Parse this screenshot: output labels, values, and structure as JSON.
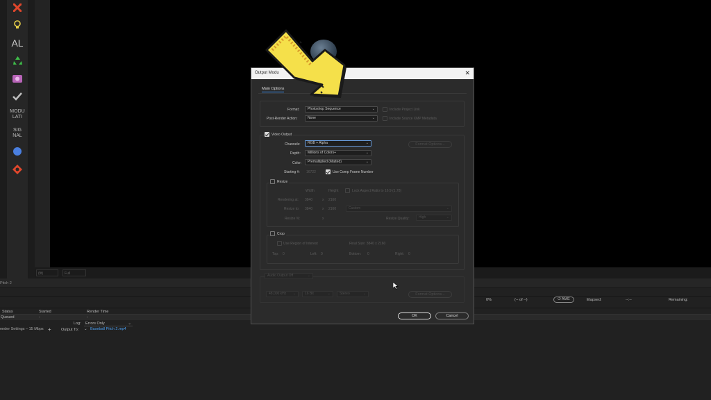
{
  "toolbar": {
    "items": [
      {
        "name": "tool-red-cross-icon",
        "glyph": "✖",
        "color": "#e0472c"
      },
      {
        "name": "lightbulb-icon",
        "glyph": "💡",
        "color": "#e8d04a"
      },
      {
        "name": "al-label",
        "text": "AL"
      },
      {
        "name": "recycle-icon",
        "glyph": "♻",
        "color": "#3fbf4a"
      },
      {
        "name": "camera-icon",
        "glyph": "📷",
        "color": "#c878c8"
      },
      {
        "name": "checkmark-icon",
        "glyph": "✔",
        "color": "#bdbdbd"
      },
      {
        "name": "modulati-label",
        "text": "MODU\nLATI"
      },
      {
        "name": "signal-label",
        "text": "SIG\nNAL"
      },
      {
        "name": "blue-dot-icon",
        "glyph": "●",
        "color": "#4a7fe0"
      },
      {
        "name": "diamond-icon",
        "glyph": "✢",
        "color": "#e0472c"
      }
    ],
    "al": "AL",
    "modulati_1": "MODU",
    "modulati_2": "LATI",
    "signal_1": "SIG",
    "signal_2": "NAL"
  },
  "viewer_bar": {
    "zoom": "(fit)",
    "quality": "Full"
  },
  "comp_tab": "Pitch 2",
  "render_queue": {
    "progress": "0%",
    "timecode": "(-- of --)",
    "elapsed_label": "Elapsed:",
    "elapsed_value": "--:--",
    "remaining_label": "Remaining:",
    "columns": [
      "Status",
      "Started",
      "Render Time"
    ],
    "status": "Queued",
    "started": "-",
    "render_time": "-",
    "log_label": "Log:",
    "log_value": "Errors Only",
    "render_settings": "ender Settings – 15 Mbps",
    "output_to_label": "Output To:",
    "output_file": "Baseball Pitch 2.mp4"
  },
  "dialog": {
    "title": "Output Modu",
    "tab_main": "Main Options",
    "format_label": "Format:",
    "format_value": "Photoshop Sequence",
    "post_render_label": "Post-Render Action:",
    "post_render_value": "None",
    "include_project_link": "Include Project Link",
    "include_xmp": "Include Source XMP Metadata",
    "video_output_label": "Video Output",
    "channels_label": "Channels:",
    "channels_value": "RGB + Alpha",
    "format_options": "Format Options...",
    "depth_label": "Depth:",
    "depth_value": "Millions of Colors+",
    "color_label": "Color:",
    "color_value": "Premultiplied (Matted)",
    "starting_label": "Starting #:",
    "starting_value": "16722",
    "use_comp_frame": "Use Comp Frame Number",
    "resize_label": "Resize",
    "width_col": "Width",
    "height_col": "Height",
    "lock_aspect": "Lock Aspect Ratio to 16:9 (1.78)",
    "rendering_at_label": "Rendering at:",
    "rendering_w": "3840",
    "rendering_h": "2160",
    "resize_to_label": "Resize to:",
    "resize_w": "3840",
    "resize_h": "2160",
    "custom": "Custom",
    "resize_pct_label": "Resize %:",
    "resize_quality_label": "Resize Quality:",
    "resize_quality_value": "High",
    "x": "x",
    "crop_label": "Crop",
    "use_roi": "Use Region of Interest",
    "final_size": "Final Size: 3840 x 2160",
    "top_label": "Top:",
    "top_value": "0",
    "left_label": "Left:",
    "left_value": "0",
    "bottom_label": "Bottom:",
    "bottom_value": "0",
    "right_label": "Right:",
    "right_value": "0",
    "audio_output": "Audio Output Off",
    "audio_rate": "48,000 kHz",
    "audio_bits": "16 Bit",
    "audio_channels": "Stereo",
    "audio_format_options": "Format Options...",
    "ok": "OK",
    "cancel": "Cancel"
  },
  "overlay": {
    "arrow_color": "#f5e04a",
    "arrow_outline": "#1a1a1a"
  }
}
